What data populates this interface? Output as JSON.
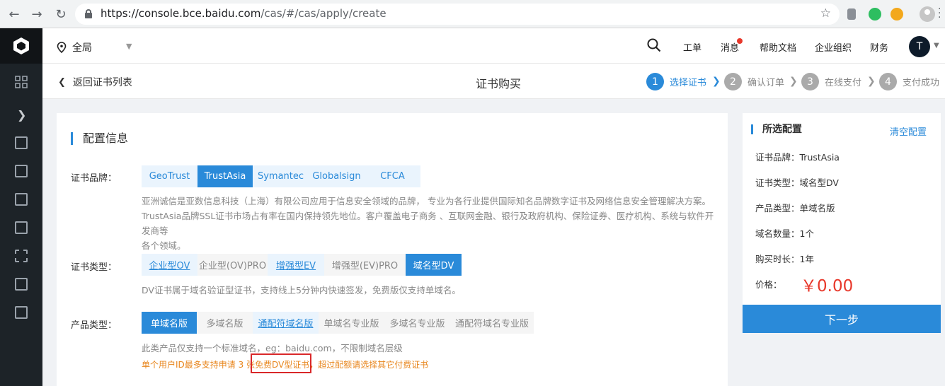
{
  "browser": {
    "url_host": "https://console.bce.baidu.com",
    "url_path": "/cas/#/cas/apply/create"
  },
  "header": {
    "region": "全局",
    "links": [
      "工单",
      "消息",
      "帮助文档",
      "企业组织",
      "财务"
    ],
    "avatar_initial": "T"
  },
  "subheader": {
    "back_label": "返回证书列表",
    "title": "证书购买",
    "steps": [
      {
        "num": "1",
        "label": "选择证书"
      },
      {
        "num": "2",
        "label": "确认订单"
      },
      {
        "num": "3",
        "label": "在线支付"
      },
      {
        "num": "4",
        "label": "支付成功"
      }
    ]
  },
  "config": {
    "title": "配置信息",
    "brand_label": "证书品牌：",
    "brands": [
      "GeoTrust",
      "TrustAsia",
      "Symantec",
      "Globalsign",
      "CFCA"
    ],
    "brand_desc_1": "亚洲诚信是亚数信息科技（上海）有限公司应用于信息安全领域的品牌， 专业为各行业提供国际知名品牌数字证书及网络信息安全管理解决方案。",
    "brand_desc_2": "TrustAsia品牌SSL证书市场占有率在国内保持领先地位。客户覆盖电子商务 、互联网金融、银行及政府机构、保险证券、医疗机构、系统与软件开发商等",
    "brand_desc_3": "各个领域。",
    "type_label": "证书类型：",
    "types": [
      "企业型OV",
      "企业型(OV)PRO",
      "增强型EV",
      "增强型(EV)PRO",
      "域名型DV"
    ],
    "type_desc": "DV证书属于域名验证型证书，支持线上5分钟内快速签发，免费版仅支持单域名。",
    "product_label": "产品类型：",
    "products": [
      "单域名版",
      "多域名版",
      "通配符域名版",
      "单域名专业版",
      "多域名专业版",
      "通配符域名专业版"
    ],
    "product_desc": "此类产品仅支持一个标准域名，eg：baidu.com，不限制域名层级",
    "warn_prefix": "单个用户ID最多支持申请 3 张",
    "warn_highlight": "免费DV型证书",
    "warn_suffix": "，超过配额请选择其它付费证书"
  },
  "summary": {
    "title": "所选配置",
    "clear": "清空配置",
    "brand": "证书品牌：TrustAsia",
    "type": "证书类型：域名型DV",
    "product": "产品类型：单域名版",
    "count": "域名数量：1个",
    "duration": "购买时长：1年",
    "price_label": "价格：",
    "price": "￥0.00",
    "next": "下一步"
  },
  "colors": {
    "accent": "#2a8ad9",
    "price": "#e8382b",
    "warning": "#e8861d",
    "sidebar": "#1d2328"
  },
  "icons": [
    "back-arrow-icon",
    "forward-arrow-icon",
    "reload-icon",
    "lock-icon",
    "bookmark-star-icon",
    "location-pin-icon",
    "search-icon",
    "chevron-right-icon"
  ]
}
